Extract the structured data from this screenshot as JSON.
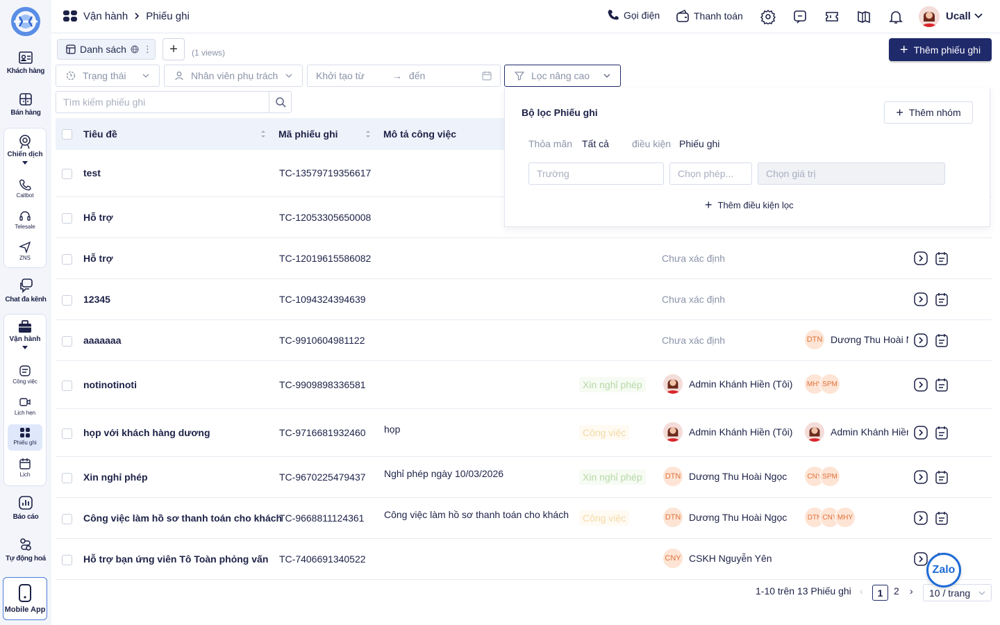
{
  "sidebar": {
    "items": [
      {
        "label": "Khách hàng"
      },
      {
        "label": "Bán hàng"
      },
      {
        "label": "Chiến dịch"
      },
      {
        "label": "Chat đa kênh"
      },
      {
        "label": "Vận hành"
      },
      {
        "label": "Báo cáo"
      },
      {
        "label": "Tự động hoá"
      }
    ],
    "campaign_sub": [
      "Callbot",
      "Telesale",
      "ZNS"
    ],
    "ops_sub": [
      "Công việc",
      "Lịch hẹn",
      "Phiếu ghi",
      "Lịch"
    ],
    "mobile": "Mobile App"
  },
  "header": {
    "breadcrumb": [
      "Vận hành",
      "Phiếu ghi"
    ],
    "call": "Gọi điện",
    "pay": "Thanh toán",
    "user": "Ucall"
  },
  "toolbar": {
    "tab_label": "Danh sách",
    "views": "(1 views)",
    "add_button": "Thêm phiếu ghi"
  },
  "filters": {
    "status": "Trạng thái",
    "owner": "Nhân viên phụ trách",
    "date_from": "Khởi tạo từ",
    "date_to": "đến",
    "advanced": "Lọc nâng cao",
    "search_placeholder": "Tìm kiếm phiếu ghi"
  },
  "table": {
    "headers": {
      "title": "Tiêu đề",
      "code": "Mã phiếu ghi",
      "desc": "Mô tả công việc"
    },
    "rows": [
      {
        "title": "test",
        "code": "TC-13579719356617",
        "desc": "",
        "tag": "",
        "status": "",
        "p1": "",
        "p1i": "",
        "p2": ""
      },
      {
        "title": "Hỗ trợ",
        "code": "TC-12053305650008",
        "desc": "",
        "tag": "",
        "status": "",
        "p1": "",
        "p1i": "",
        "p2": ""
      },
      {
        "title": "Hỗ trợ",
        "code": "TC-12019615586082",
        "desc": "",
        "tag": "",
        "status": "Chưa xác định",
        "p1": "",
        "p1i": "",
        "p2": ""
      },
      {
        "title": "12345",
        "code": "TC-1094324394639",
        "desc": "",
        "tag": "",
        "status": "Chưa xác định",
        "p1": "",
        "p1i": "",
        "p2": ""
      },
      {
        "title": "aaaaaaa",
        "code": "TC-9910604981122",
        "desc": "",
        "tag": "",
        "status": "Chưa xác định",
        "p1": "",
        "p1i": "",
        "p2": "Dương Thu Hoài Ngọc",
        "p2i": "DTN"
      },
      {
        "title": "notinotinoti",
        "code": "TC-9909898336581",
        "desc": "",
        "tag": "Xin nghỉ phép",
        "status": "",
        "p1": "Admin Khánh Hiền (Tôi)",
        "p1i": "photo",
        "p2": "",
        "stack": [
          "MHY",
          "SPM"
        ]
      },
      {
        "title": "họp với khách hàng dương",
        "code": "TC-9716681932460",
        "desc": "họp",
        "tag": "Công việc",
        "status": "",
        "p1": "Admin Khánh Hiền (Tôi)",
        "p1i": "photo",
        "p2": "Admin Khánh Hiền (Tôi)",
        "p2i": "photo"
      },
      {
        "title": "Xin nghỉ phép",
        "code": "TC-9670225479437",
        "desc": "Nghỉ phép ngày 10/03/2026",
        "tag": "Xin nghỉ phép",
        "status": "",
        "p1": "Dương Thu Hoài Ngọc",
        "p1i": "DTN",
        "p2": "",
        "stack": [
          "CNY",
          "SPM"
        ]
      },
      {
        "title": "Công việc làm hồ sơ thanh toán cho khách",
        "code": "TC-9668811124361",
        "desc": "Công việc làm hồ sơ thanh toán cho khách",
        "tag": "Công việc",
        "status": "",
        "p1": "Dương Thu Hoài Ngọc",
        "p1i": "DTN",
        "p2": "",
        "stack": [
          "DTN",
          "CNY",
          "MHY"
        ]
      },
      {
        "title": "Hỗ trợ bạn ứng viên Tô Toàn phỏng vấn",
        "code": "TC-7406691340522",
        "desc": "",
        "tag": "",
        "status": "",
        "p1": "CSKH Nguyễn Yên",
        "p1i": "CNY",
        "p2": ""
      }
    ]
  },
  "popover": {
    "title": "Bộ lọc Phiếu ghi",
    "add_group": "Thêm nhóm",
    "match": "Thỏa mãn",
    "match_value": "Tất cả",
    "condition": "điều kiện",
    "condition_value": "Phiếu ghi",
    "field_placeholder": "Trường",
    "op_placeholder": "Chọn phép...",
    "value_placeholder": "Chọn giá trị",
    "add_condition": "Thêm điều kiện lọc"
  },
  "pagination": {
    "summary": "1-10 trên 13 Phiếu ghi",
    "pages": [
      "1",
      "2"
    ],
    "page_size": "10 / trang"
  },
  "zalo": "Zalo",
  "colors": {
    "primary": "#1f2a6b",
    "accent": "#1e6bd6"
  }
}
